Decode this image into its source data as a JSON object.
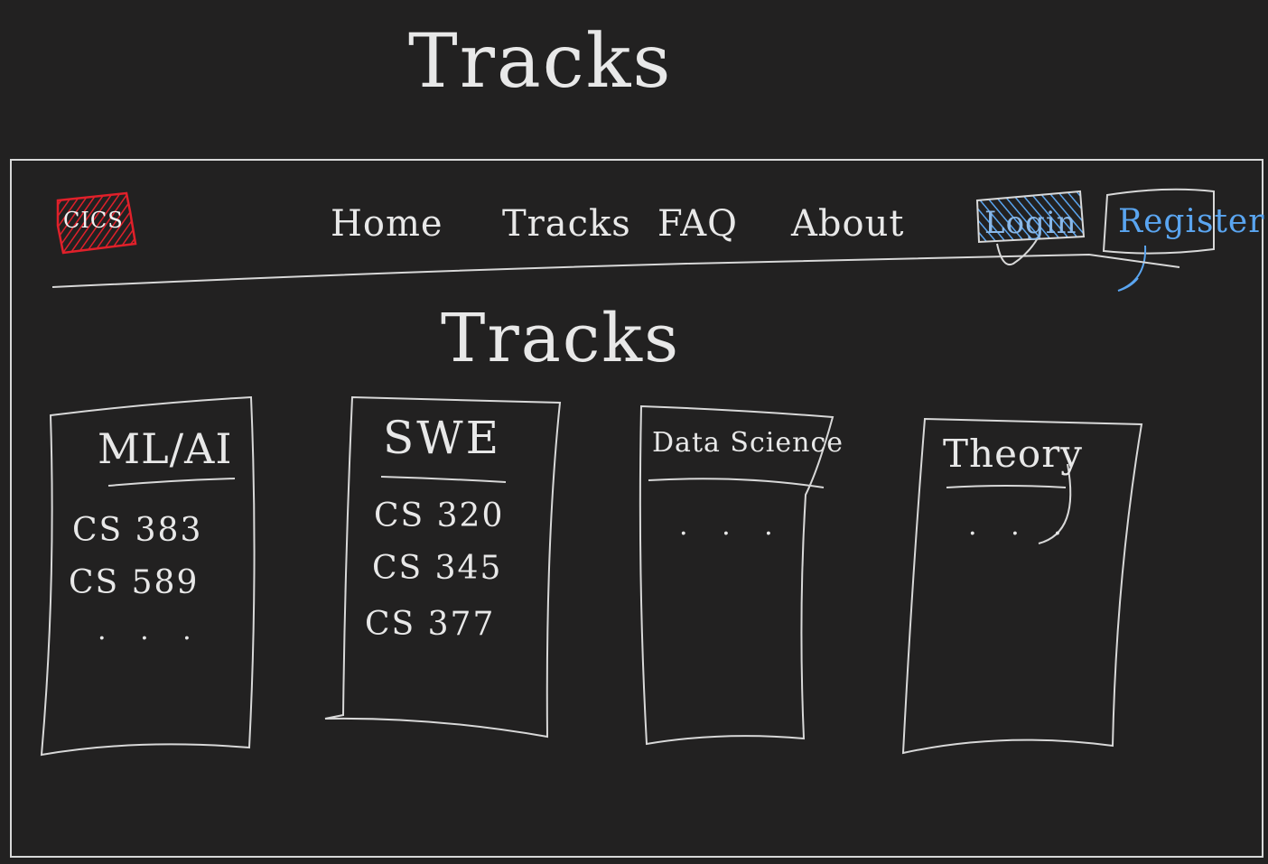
{
  "page": {
    "heading": "Tracks"
  },
  "header": {
    "logo_text": "CICS",
    "nav": {
      "home": "Home",
      "tracks": "Tracks",
      "faq": "FAQ",
      "about": "About"
    },
    "login_label": "Login",
    "register_label": "Register"
  },
  "main": {
    "heading": "Tracks",
    "cards": [
      {
        "title": "ML/AI",
        "courses": [
          "CS 383",
          "CS 589",
          ". . ."
        ]
      },
      {
        "title": "SWE",
        "courses": [
          "CS 320",
          "CS 345",
          "CS 377"
        ]
      },
      {
        "title": "Data Science",
        "courses": [
          ". . ."
        ]
      },
      {
        "title": "Theory",
        "courses": [
          ". . ."
        ]
      }
    ]
  },
  "colors": {
    "background": "#222121",
    "ink": "#e8e8e8",
    "logo_red": "#e0202a",
    "accent_blue": "#5aa5f0"
  },
  "icons": {
    "logo": "logo-icon"
  }
}
